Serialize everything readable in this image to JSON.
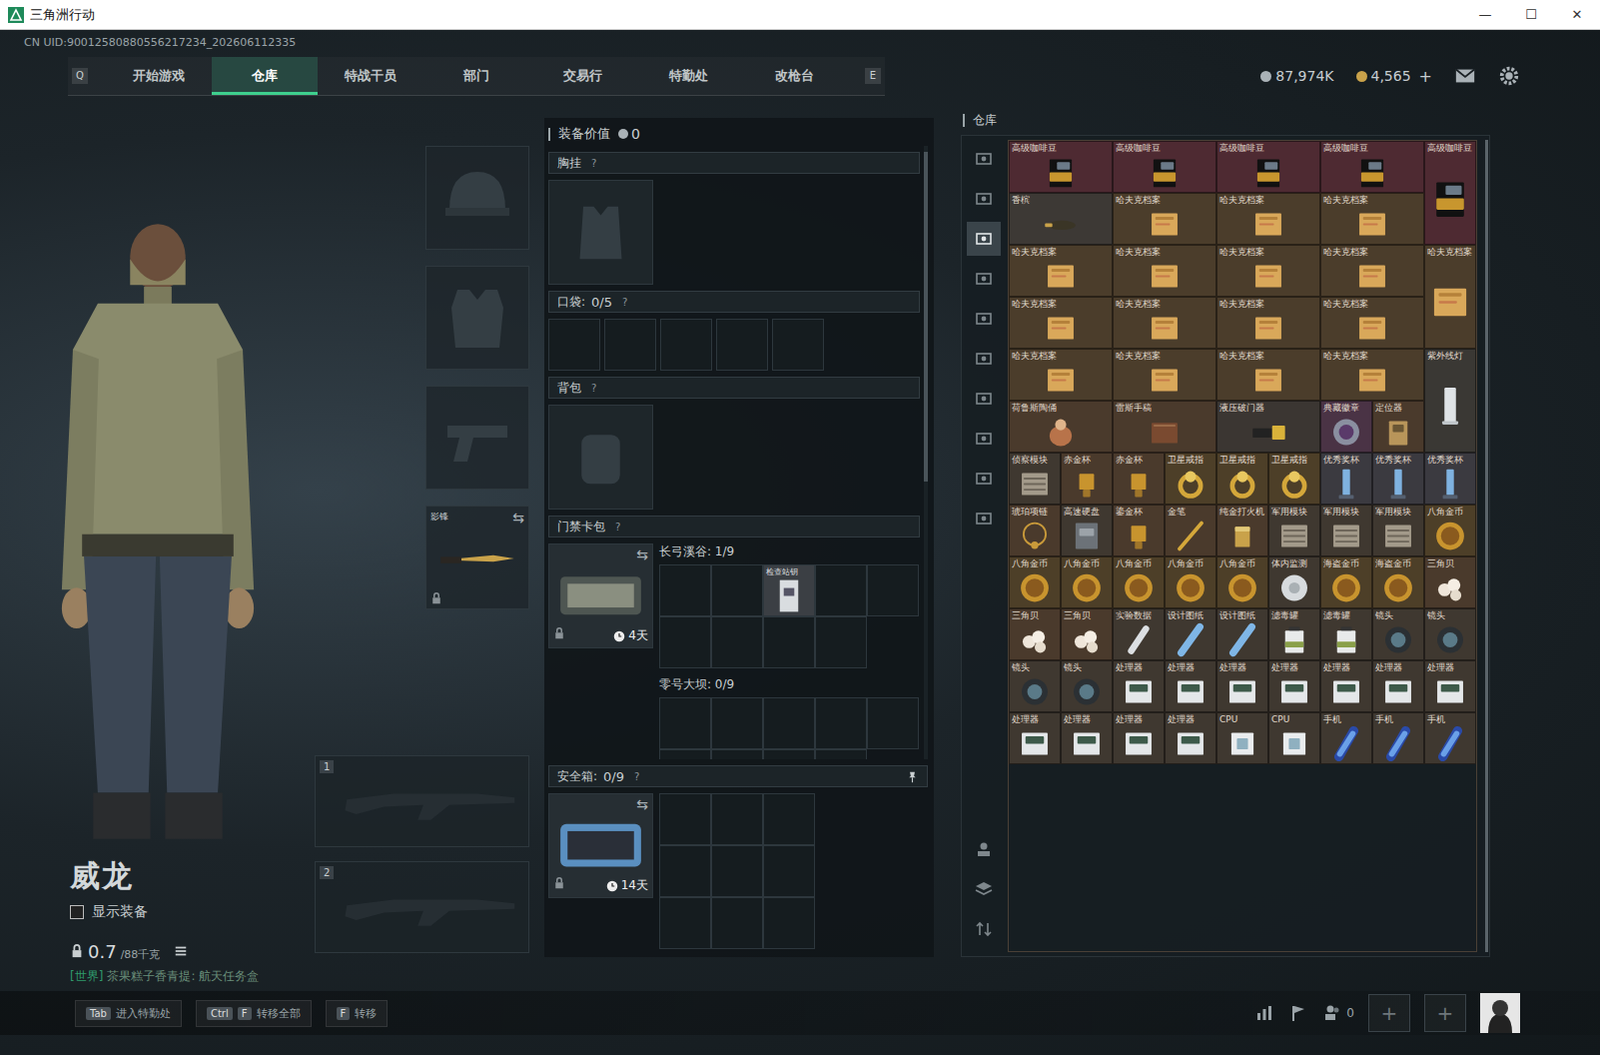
{
  "window": {
    "title": "三角洲行动",
    "controls": [
      "—",
      "☐",
      "✕"
    ]
  },
  "uid": "CN UID:90012580880556217234_202606112335",
  "nav": {
    "left_key": "Q",
    "right_key": "E",
    "tabs": [
      {
        "label": "开始游戏",
        "selected": false
      },
      {
        "label": "仓库",
        "selected": true
      },
      {
        "label": "特战干员",
        "selected": false
      },
      {
        "label": "部门",
        "selected": false
      },
      {
        "label": "交易行",
        "selected": false
      },
      {
        "label": "特勤处",
        "selected": false
      },
      {
        "label": "改枪台",
        "selected": false
      }
    ]
  },
  "currencies": [
    {
      "value": "87,974K",
      "color": "#aab2b7"
    },
    {
      "value": "4,565",
      "color": "#c9a24a",
      "add": "+"
    }
  ],
  "operator": {
    "name": "威龙",
    "show_gear": {
      "label": "显示装备",
      "checked": false
    },
    "weight": "0.7",
    "capacity": "/88千克"
  },
  "chat": {
    "channel": "[世界]",
    "text": "茶果糕子香青提: 航天任务盒"
  },
  "gear_slots": [
    {
      "kind": "helmet"
    },
    {
      "kind": "armor"
    },
    {
      "kind": "pistol"
    },
    {
      "kind": "melee",
      "label": "影锋",
      "locked": true,
      "swap": "⇆"
    }
  ],
  "weapon_slots": [
    {
      "number": "1"
    },
    {
      "number": "2"
    }
  ],
  "loadout": {
    "value_label": "装备价值",
    "value": "0",
    "chest": {
      "label": "胸挂",
      "help": "?"
    },
    "pockets": {
      "label": "口袋:",
      "count": "0/5",
      "help": "?",
      "slots": [
        {
          "filled": false
        },
        {
          "filled": false
        },
        {
          "filled": false
        },
        {
          "filled": false
        },
        {
          "filled": false
        }
      ]
    },
    "backpack": {
      "label": "背包",
      "help": "?"
    },
    "keycard": {
      "label": "门禁卡包",
      "help": "?",
      "timer": "4天",
      "locked": true,
      "swap": "⇆",
      "maps": [
        {
          "name": "长弓溪谷: 1/9",
          "cells": [
            {
              "filled": false
            },
            {
              "filled": false
            },
            {
              "filled": true,
              "label": "检查站钥"
            },
            {
              "filled": false
            },
            {
              "filled": false
            },
            {
              "filled": false
            },
            {
              "filled": false
            },
            {
              "filled": false
            },
            {
              "filled": false
            }
          ]
        },
        {
          "name": "零号大坝: 0/9",
          "cells": [
            {
              "filled": false
            },
            {
              "filled": false
            },
            {
              "filled": false
            },
            {
              "filled": false
            },
            {
              "filled": false
            },
            {
              "filled": false
            },
            {
              "filled": false
            },
            {
              "filled": false
            },
            {
              "filled": false
            }
          ]
        }
      ]
    },
    "safebox": {
      "label": "安全箱:",
      "count": "0/9",
      "help": "?",
      "timer": "14天",
      "locked": true,
      "swap": "⇆",
      "cells": [
        {
          "filled": false
        },
        {
          "filled": false
        },
        {
          "filled": false
        },
        {
          "filled": false
        },
        {
          "filled": false
        },
        {
          "filled": false
        },
        {
          "filled": false
        },
        {
          "filled": false
        },
        {
          "filled": false
        }
      ]
    }
  },
  "warehouse": {
    "title": "仓库",
    "side_tabs": [
      {
        "selected": false
      },
      {
        "selected": false
      },
      {
        "selected": true
      },
      {
        "selected": false
      },
      {
        "selected": false
      },
      {
        "selected": false
      },
      {
        "selected": false
      },
      {
        "selected": false
      },
      {
        "selected": false
      },
      {
        "selected": false
      }
    ],
    "side_tools": [
      {
        "kind": "operator"
      },
      {
        "kind": "layers"
      },
      {
        "kind": "sort"
      }
    ],
    "items": [
      {
        "name": "高级咖啡豆",
        "kind": "coffee",
        "rotated": false,
        "color": "#4e2a32"
      },
      {
        "name": "高级咖啡豆",
        "kind": "coffee",
        "rotated": false,
        "color": "#4e2a32"
      },
      {
        "name": "高级咖啡豆",
        "kind": "coffee",
        "rotated": false,
        "color": "#4e2a32"
      },
      {
        "name": "高级咖啡豆",
        "kind": "coffee",
        "rotated": false,
        "color": "#4e2a32"
      },
      {
        "name": "高级咖啡豆",
        "kind": "coffee",
        "rotated": true,
        "color": "#4e2a32"
      },
      {
        "name": "香槟",
        "kind": "champagne",
        "rotated": false,
        "color": "#3d3935"
      },
      {
        "name": "哈夫克档案",
        "kind": "archive",
        "rotated": false,
        "color": "#4b3d2b"
      },
      {
        "name": "哈夫克档案",
        "kind": "archive",
        "rotated": false,
        "color": "#4b3d2b"
      },
      {
        "name": "哈夫克档案",
        "kind": "archive",
        "rotated": false,
        "color": "#4b3d2b"
      },
      {
        "name": "哈夫克档案",
        "kind": "archive",
        "rotated": false,
        "color": "#4b3d2b"
      },
      {
        "name": "哈夫克档案",
        "kind": "archive",
        "rotated": false,
        "color": "#4b3d2b"
      },
      {
        "name": "哈夫克档案",
        "kind": "archive",
        "rotated": false,
        "color": "#4b3d2b"
      },
      {
        "name": "哈夫克档案",
        "kind": "archive",
        "rotated": false,
        "color": "#4b3d2b"
      },
      {
        "name": "哈夫克档案",
        "kind": "archive",
        "rotated": true,
        "color": "#4b3d2b"
      },
      {
        "name": "哈夫克档案",
        "kind": "archive",
        "rotated": false,
        "color": "#4b3d2b"
      },
      {
        "name": "哈夫克档案",
        "kind": "archive",
        "rotated": false,
        "color": "#4b3d2b"
      },
      {
        "name": "哈夫克档案",
        "kind": "archive",
        "rotated": false,
        "color": "#4b3d2b"
      },
      {
        "name": "哈夫克档案",
        "kind": "archive",
        "rotated": false,
        "color": "#4b3d2b"
      },
      {
        "name": "哈夫克档案",
        "kind": "archive",
        "rotated": false,
        "color": "#4b3d2b"
      },
      {
        "name": "哈夫克档案",
        "kind": "archive",
        "rotated": false,
        "color": "#4b3d2b"
      },
      {
        "name": "哈夫克档案",
        "kind": "archive",
        "rotated": false,
        "color": "#4b3d2b"
      },
      {
        "name": "哈夫克档案",
        "kind": "archive",
        "rotated": false,
        "color": "#4b3d2b"
      },
      {
        "name": "紫外线灯",
        "kind": "lamp",
        "rotated": false,
        "color": "#3a3834"
      },
      {
        "name": "荷鲁斯陶俑",
        "kind": "statue",
        "rotated": false,
        "color": "#4a3a2c"
      },
      {
        "name": "雷斯手稿",
        "kind": "book",
        "rotated": false,
        "color": "#4a3a2c"
      },
      {
        "name": "液压破门器",
        "kind": "breaker",
        "rotated": false,
        "color": "#3b3632"
      },
      {
        "name": "典藏徽章",
        "kind": "badge",
        "rotated": false,
        "color": "#4a3345"
      },
      {
        "name": "定位器",
        "kind": "locator",
        "rotated": false,
        "color": "#4a3a2c"
      },
      {
        "name": "侦察模块",
        "kind": "module",
        "rotated": false,
        "color": "#3f3830"
      },
      {
        "name": "赤金杯",
        "kind": "cup",
        "rotated": false,
        "color": "#4a3a2c"
      },
      {
        "name": "赤金杯",
        "kind": "cup",
        "rotated": false,
        "color": "#4a3a2c"
      },
      {
        "name": "卫星戒指",
        "kind": "ring",
        "rotated": false,
        "color": "#4d3f28"
      },
      {
        "name": "卫星戒指",
        "kind": "ring",
        "rotated": false,
        "color": "#4d3f28"
      },
      {
        "name": "卫星戒指",
        "kind": "ring",
        "rotated": false,
        "color": "#4d3f28"
      },
      {
        "name": "优秀奖杯",
        "kind": "trophy",
        "rotated": false,
        "color": "#3b3a40"
      },
      {
        "name": "优秀奖杯",
        "kind": "trophy",
        "rotated": false,
        "color": "#3b3a40"
      },
      {
        "name": "优秀奖杯",
        "kind": "trophy",
        "rotated": false,
        "color": "#3b3a40"
      },
      {
        "name": "琥珀项链",
        "kind": "necklace",
        "rotated": false,
        "color": "#4a3a2c"
      },
      {
        "name": "高速硬盘",
        "kind": "drive",
        "rotated": false,
        "color": "#3f3830"
      },
      {
        "name": "鎏金杯",
        "kind": "cup",
        "rotated": false,
        "color": "#4a3a2c"
      },
      {
        "name": "金笔",
        "kind": "pen",
        "rotated": false,
        "color": "#4a3a2c"
      },
      {
        "name": "纯金打火机",
        "kind": "lighter",
        "rotated": false,
        "color": "#4a3a2c"
      },
      {
        "name": "军用模块",
        "kind": "module",
        "rotated": false,
        "color": "#3f3830"
      },
      {
        "name": "军用模块",
        "kind": "module",
        "rotated": false,
        "color": "#3f3830"
      },
      {
        "name": "军用模块",
        "kind": "module",
        "rotated": false,
        "color": "#3f3830"
      },
      {
        "name": "八角金币",
        "kind": "coin",
        "rotated": false,
        "color": "#4d3f28"
      },
      {
        "name": "八角金币",
        "kind": "coin",
        "rotated": false,
        "color": "#4d3f28"
      },
      {
        "name": "八角金币",
        "kind": "coin",
        "rotated": false,
        "color": "#4d3f28"
      },
      {
        "name": "八角金币",
        "kind": "coin",
        "rotated": false,
        "color": "#4d3f28"
      },
      {
        "name": "八角金币",
        "kind": "coin",
        "rotated": false,
        "color": "#4d3f28"
      },
      {
        "name": "八角金币",
        "kind": "coin",
        "rotated": false,
        "color": "#4d3f28"
      },
      {
        "name": "体内监测",
        "kind": "disc",
        "rotated": false,
        "color": "#3f3830"
      },
      {
        "name": "海盗金币",
        "kind": "coin",
        "rotated": false,
        "color": "#4d3f28"
      },
      {
        "name": "海盗金币",
        "kind": "coin",
        "rotated": false,
        "color": "#4d3f28"
      },
      {
        "name": "三角贝",
        "kind": "pearl",
        "rotated": false,
        "color": "#4a3a2c"
      },
      {
        "name": "三角贝",
        "kind": "pearl",
        "rotated": false,
        "color": "#4a3a2c"
      },
      {
        "name": "三角贝",
        "kind": "pearl",
        "rotated": false,
        "color": "#4a3a2c"
      },
      {
        "name": "实验数据",
        "kind": "usb",
        "rotated": false,
        "color": "#3f3830"
      },
      {
        "name": "设计图纸",
        "kind": "blueprint",
        "rotated": false,
        "color": "#3f3830"
      },
      {
        "name": "设计图纸",
        "kind": "blueprint",
        "rotated": false,
        "color": "#3f3830"
      },
      {
        "name": "滤毒罐",
        "kind": "canister",
        "rotated": false,
        "color": "#3f3830"
      },
      {
        "name": "滤毒罐",
        "kind": "canister",
        "rotated": false,
        "color": "#3f3830"
      },
      {
        "name": "镜头",
        "kind": "lens",
        "rotated": false,
        "color": "#3f3830"
      },
      {
        "name": "镜头",
        "kind": "lens",
        "rotated": false,
        "color": "#3f3830"
      },
      {
        "name": "镜头",
        "kind": "lens",
        "rotated": false,
        "color": "#3f3830"
      },
      {
        "name": "镜头",
        "kind": "lens",
        "rotated": false,
        "color": "#3f3830"
      },
      {
        "name": "处理器",
        "kind": "processor",
        "rotated": false,
        "color": "#3f3830"
      },
      {
        "name": "处理器",
        "kind": "processor",
        "rotated": false,
        "color": "#3f3830"
      },
      {
        "name": "处理器",
        "kind": "processor",
        "rotated": false,
        "color": "#3f3830"
      },
      {
        "name": "处理器",
        "kind": "processor",
        "rotated": false,
        "color": "#3f3830"
      },
      {
        "name": "处理器",
        "kind": "processor",
        "rotated": false,
        "color": "#3f3830"
      },
      {
        "name": "处理器",
        "kind": "processor",
        "rotated": false,
        "color": "#3f3830"
      },
      {
        "name": "处理器",
        "kind": "processor",
        "rotated": false,
        "color": "#3f3830"
      },
      {
        "name": "处理器",
        "kind": "processor",
        "rotated": false,
        "color": "#3f3830"
      },
      {
        "name": "处理器",
        "kind": "processor",
        "rotated": false,
        "color": "#3f3830"
      },
      {
        "name": "处理器",
        "kind": "processor",
        "rotated": false,
        "color": "#3f3830"
      },
      {
        "name": "处理器",
        "kind": "processor",
        "rotated": false,
        "color": "#3f3830"
      },
      {
        "name": "CPU",
        "kind": "cpu",
        "rotated": false,
        "color": "#3f3830"
      },
      {
        "name": "CPU",
        "kind": "cpu",
        "rotated": false,
        "color": "#3f3830"
      },
      {
        "name": "手机",
        "kind": "phone",
        "rotated": false,
        "color": "#3f3830"
      },
      {
        "name": "手机",
        "kind": "phone",
        "rotated": false,
        "color": "#3f3830"
      },
      {
        "name": "手机",
        "kind": "phone",
        "rotated": false,
        "color": "#3f3830"
      }
    ]
  },
  "bottom_hints": [
    {
      "keys": [
        "Tab"
      ],
      "label": "进入特勤处"
    },
    {
      "keys": [
        "Ctrl",
        "F"
      ],
      "label": "转移全部"
    },
    {
      "keys": [
        "F"
      ],
      "label": "转移"
    }
  ],
  "social": {
    "squad_count": "0",
    "party_slots": [
      "+",
      "+"
    ]
  }
}
